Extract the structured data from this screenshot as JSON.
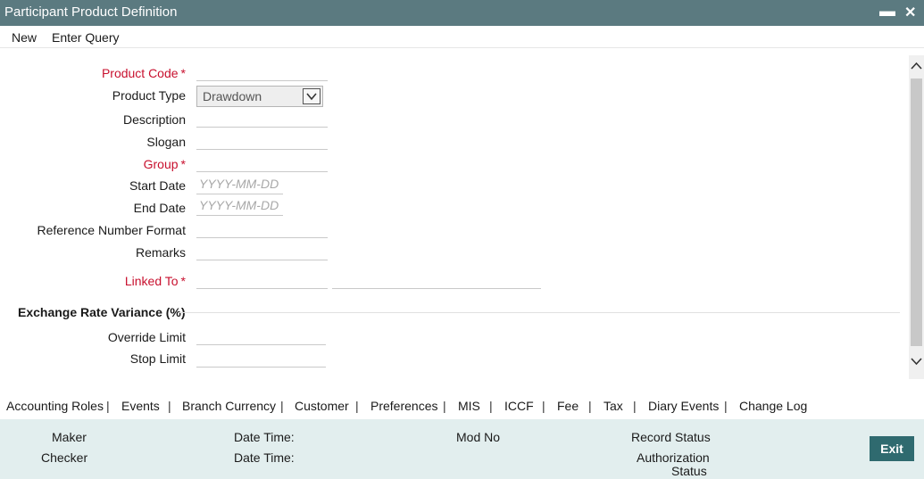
{
  "window": {
    "title": "Participant Product Definition",
    "minimize_glyph": "▬",
    "close_glyph": "✕"
  },
  "menu": {
    "new_label": "New",
    "enter_query_label": "Enter Query"
  },
  "form": {
    "product_code": {
      "label": "Product Code",
      "required": "*",
      "value": ""
    },
    "product_type": {
      "label": "Product Type",
      "value": "Drawdown"
    },
    "description": {
      "label": "Description",
      "value": ""
    },
    "slogan": {
      "label": "Slogan",
      "value": ""
    },
    "group": {
      "label": "Group",
      "required": "*",
      "value": ""
    },
    "start_date": {
      "label": "Start Date",
      "placeholder": "YYYY-MM-DD"
    },
    "end_date": {
      "label": "End Date",
      "placeholder": "YYYY-MM-DD"
    },
    "reference_number_format": {
      "label": "Reference Number Format",
      "value": ""
    },
    "remarks": {
      "label": "Remarks",
      "value": ""
    },
    "linked_to": {
      "label": "Linked To",
      "required": "*",
      "value": "",
      "description": ""
    }
  },
  "exchange_rate_variance": {
    "section_title": "Exchange Rate Variance (%)",
    "override_limit": {
      "label": "Override Limit",
      "value": ""
    },
    "stop_limit": {
      "label": "Stop Limit",
      "value": ""
    }
  },
  "tabs": [
    "Accounting Roles",
    "Events",
    "Branch Currency",
    "Customer",
    "Preferences",
    "MIS",
    "ICCF",
    "Fee",
    "Tax",
    "Diary Events",
    "Change Log"
  ],
  "tab_separator": "|",
  "footer": {
    "maker": "Maker",
    "checker": "Checker",
    "date_time_1": "Date Time:",
    "date_time_2": "Date Time:",
    "mod_no": "Mod No",
    "record_status": "Record Status",
    "authorization_status_line1": "Authorization",
    "authorization_status_line2": "Status",
    "exit_label": "Exit"
  },
  "colors": {
    "titlebar": "#5b7a80",
    "required": "#c8102e",
    "footer_bg": "#e2eeee",
    "exit_button": "#2f6a6f"
  }
}
